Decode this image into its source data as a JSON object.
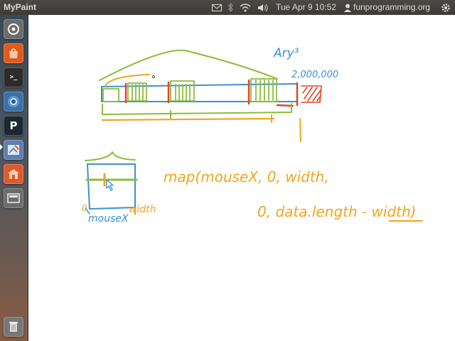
{
  "panel": {
    "app_title": "MyPaint",
    "clock": "Tue Apr  9 10:52",
    "user": "funprogramming.org",
    "indicators": [
      "mail-icon",
      "bluetooth-icon",
      "wifi-icon",
      "volume-icon",
      "user-icon",
      "gear-icon"
    ]
  },
  "launcher": {
    "items": [
      {
        "name": "dash-home-icon",
        "color": "#6b6b6b",
        "glyph": "◎"
      },
      {
        "name": "software-center-icon",
        "color": "#e05a1c",
        "glyph": ""
      },
      {
        "name": "terminal-icon",
        "color": "#2b2b2b",
        "glyph": ">_"
      },
      {
        "name": "chromium-icon",
        "color": "#3d6fa8",
        "glyph": "◉"
      },
      {
        "name": "processing-icon",
        "color": "#1c2733",
        "glyph": "P"
      },
      {
        "name": "mypaint-icon",
        "color": "#5f7fae",
        "glyph": "✎"
      },
      {
        "name": "home-folder-icon",
        "color": "#dd5a2a",
        "glyph": "⌂"
      },
      {
        "name": "workspace-switcher-icon",
        "color": "#6c6c6c",
        "glyph": "▭"
      }
    ],
    "trash": {
      "name": "trash-icon",
      "color": "#777777",
      "glyph": "🗑"
    }
  },
  "drawing": {
    "top_label": "Ary³",
    "big_number": "2,000,000",
    "formula_line1": "map(mouseX, 0, width,",
    "formula_line2": "0, data.length - width)",
    "label_zero": "0",
    "label_mousex": "mouseX",
    "label_width": "width",
    "colors": {
      "blue": "#3d8fd6",
      "green": "#8cbd3a",
      "orange": "#f2a51a",
      "red": "#e04424"
    }
  }
}
